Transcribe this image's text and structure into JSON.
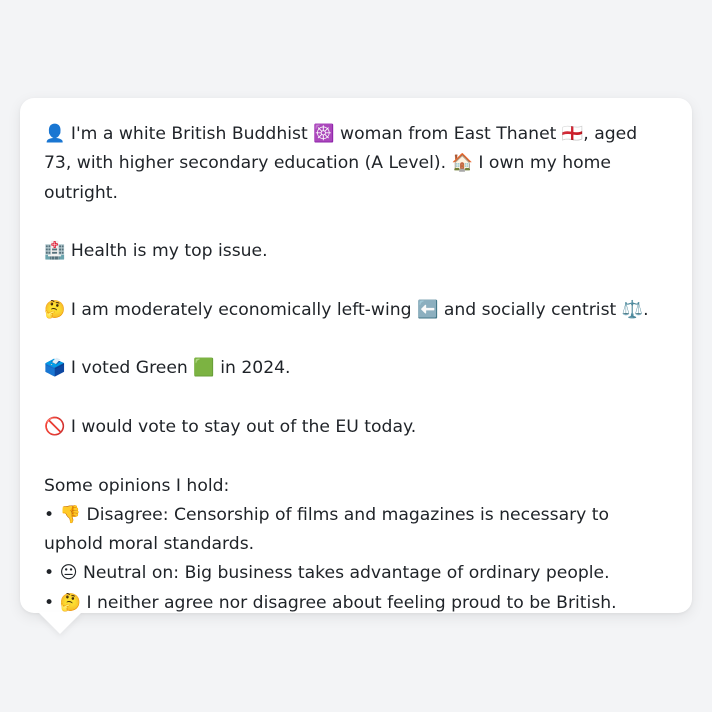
{
  "message": {
    "profile": {
      "person_icon": "👤",
      "text_a": "I'm a white British Buddhist",
      "religion_icon": "☸️",
      "text_b": "woman from East Thanet",
      "flag_icon": "🏴󠁧󠁢󠁥󠁮󠁧󠁿",
      "text_c": ", aged 73, with higher secondary education (A Level).",
      "home_icon": "🏠",
      "text_d": "I own my home outright."
    },
    "issue": {
      "icon": "🏥",
      "text": "Health is my top issue."
    },
    "ideology": {
      "think_icon": "🤔",
      "text_a": "I am moderately economically left-wing",
      "left_arrow_icon": "⬅️",
      "text_b": "and socially centrist",
      "scales_icon": "⚖️",
      "text_c": "."
    },
    "vote": {
      "ballot_icon": "🗳️",
      "text_a": "I voted Green",
      "green_square_icon": "🟩",
      "text_b": "in 2024."
    },
    "eu": {
      "no_entry_icon": "🚫",
      "text": "I would vote to stay out of the EU today."
    },
    "opinions": {
      "heading": "Some opinions I hold:",
      "items": [
        {
          "bullet": "•",
          "icon": "👎",
          "text": "Disagree: Censorship of films and magazines is necessary to uphold moral standards."
        },
        {
          "bullet": "•",
          "icon": "😐",
          "text": "Neutral on: Big business takes advantage of ordinary people."
        },
        {
          "bullet": "•",
          "icon": "🤔",
          "text": "I neither agree nor disagree about feeling proud to be British."
        }
      ]
    }
  }
}
